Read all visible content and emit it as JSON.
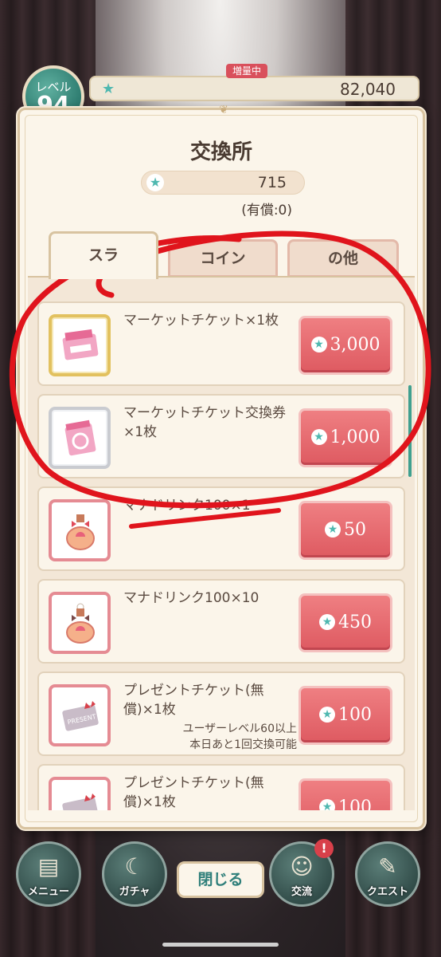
{
  "hud": {
    "level_label": "レベル",
    "level_value": "94",
    "boost_tag": "増量中",
    "star_total": "82,040"
  },
  "dialog": {
    "title": "交換所",
    "currency_value": "715",
    "paid_note": "(有償:0)",
    "tabs": [
      {
        "label": "スラ"
      },
      {
        "label": "コイン"
      },
      {
        "label": "の他"
      }
    ],
    "items": [
      {
        "name": "マーケットチケット×1枚",
        "note": "",
        "price": "3,000",
        "frame": "gold",
        "icon": "market-ticket-icon"
      },
      {
        "name": "マーケットチケット交換券×1枚",
        "note": "",
        "price": "1,000",
        "frame": "silver",
        "icon": "exchange-ticket-icon"
      },
      {
        "name": "マナドリンク100×1",
        "note": "",
        "price": "50",
        "frame": "pink",
        "icon": "mana-drink-icon"
      },
      {
        "name": "マナドリンク100×10",
        "note": "",
        "price": "450",
        "frame": "pink",
        "icon": "mana-drink-icon"
      },
      {
        "name": "プレゼントチケット(無償)×1枚",
        "note_line1": "ユーザーレベル60以上",
        "note_line2": "本日あと1回交換可能",
        "price": "100",
        "frame": "pink",
        "icon": "present-ticket-icon"
      },
      {
        "name": "プレゼントチケット(無償)×1枚",
        "note": "",
        "price": "100",
        "frame": "pink",
        "icon": "present-ticket-icon"
      }
    ],
    "close_label": "閉じる"
  },
  "bottom_nav": [
    {
      "label": "メニュー",
      "icon": "book-icon"
    },
    {
      "label": "ガチャ",
      "icon": "moon-icon"
    },
    {
      "label": "交流",
      "icon": "people-icon",
      "badge": "!"
    },
    {
      "label": "クエスト",
      "icon": "quest-icon"
    }
  ],
  "colors": {
    "accent_teal": "#3fa08f",
    "price_red": "#de5a61",
    "annotation_red": "#e0141c"
  }
}
